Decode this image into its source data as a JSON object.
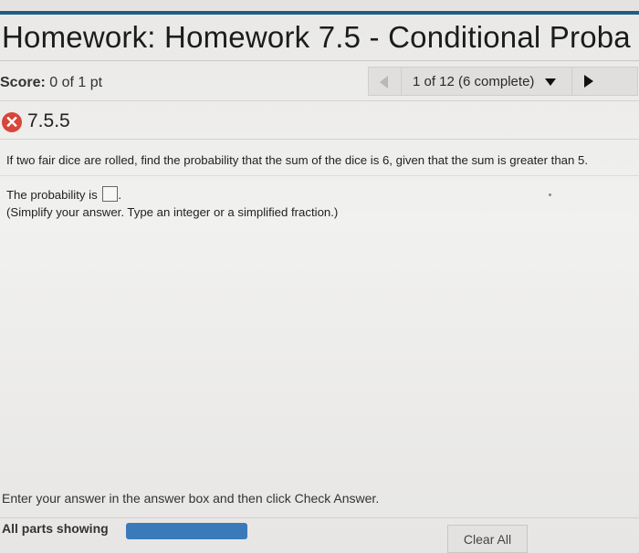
{
  "header": {
    "title": "Homework: Homework 7.5 - Conditional Proba"
  },
  "score": {
    "label": "Score:",
    "value": "0 of 1 pt"
  },
  "navigation": {
    "progress_text": "1 of 12 (6 complete)",
    "prev_icon": "triangle-left-icon",
    "next_icon": "triangle-right-icon",
    "dropdown_icon": "triangle-down-icon"
  },
  "question": {
    "status_icon": "x-circle-icon",
    "status_color": "#d8453b",
    "number": "7.5.5",
    "prompt": "If two fair dice are rolled, find the probability that the sum of the dice is 6, given that the sum is greater than 5.",
    "answer_label": "The probability is",
    "answer_value": "",
    "answer_suffix": ".",
    "hint": "(Simplify your answer. Type an integer or a simplified fraction.)"
  },
  "footer": {
    "instructions": "Enter your answer in the answer box and then click Check Answer.",
    "parts_label": "All parts showing",
    "progress_color": "#3b7ab8",
    "clear_label": "Clear All"
  }
}
